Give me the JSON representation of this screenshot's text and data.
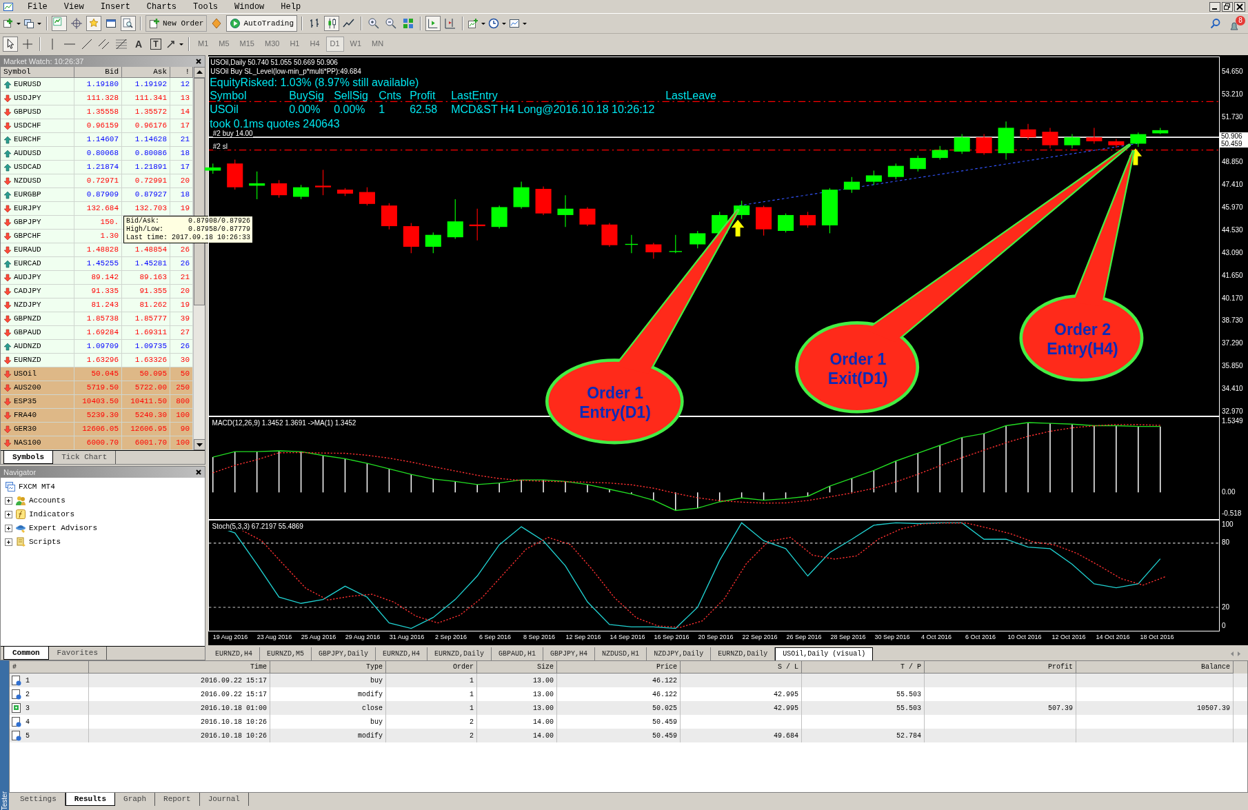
{
  "menu": [
    "File",
    "View",
    "Insert",
    "Charts",
    "Tools",
    "Window",
    "Help"
  ],
  "toolbar": {
    "new_order": "New Order",
    "autotrading": "AutoTrading",
    "text_tools": [
      "A",
      "T"
    ]
  },
  "timeframes": [
    {
      "label": "M1",
      "selected": false,
      "disabled": true
    },
    {
      "label": "M5",
      "selected": false,
      "disabled": true
    },
    {
      "label": "M15",
      "selected": false,
      "disabled": true
    },
    {
      "label": "M30",
      "selected": false,
      "disabled": true
    },
    {
      "label": "H1",
      "selected": false,
      "disabled": true
    },
    {
      "label": "H4",
      "selected": false,
      "disabled": true
    },
    {
      "label": "D1",
      "selected": true,
      "disabled": true
    },
    {
      "label": "W1",
      "selected": false,
      "disabled": true
    },
    {
      "label": "MN",
      "selected": false,
      "disabled": true
    }
  ],
  "notification_count": "8",
  "market_watch": {
    "title": "Market Watch: 10:26:37",
    "columns": [
      "Symbol",
      "Bid",
      "Ask",
      "!"
    ],
    "rows": [
      {
        "symbol": "EURUSD",
        "bid": "1.19180",
        "ask": "1.19192",
        "spread": "12",
        "rising": true,
        "highlighted": false
      },
      {
        "symbol": "USDJPY",
        "bid": "111.328",
        "ask": "111.341",
        "spread": "13",
        "rising": false,
        "highlighted": false
      },
      {
        "symbol": "GBPUSD",
        "bid": "1.35558",
        "ask": "1.35572",
        "spread": "14",
        "rising": false,
        "highlighted": false
      },
      {
        "symbol": "USDCHF",
        "bid": "0.96159",
        "ask": "0.96176",
        "spread": "17",
        "rising": false,
        "highlighted": false
      },
      {
        "symbol": "EURCHF",
        "bid": "1.14607",
        "ask": "1.14628",
        "spread": "21",
        "rising": true,
        "highlighted": false
      },
      {
        "symbol": "AUDUSD",
        "bid": "0.80068",
        "ask": "0.80086",
        "spread": "18",
        "rising": true,
        "highlighted": false
      },
      {
        "symbol": "USDCAD",
        "bid": "1.21874",
        "ask": "1.21891",
        "spread": "17",
        "rising": true,
        "highlighted": false
      },
      {
        "symbol": "NZDUSD",
        "bid": "0.72971",
        "ask": "0.72991",
        "spread": "20",
        "rising": false,
        "highlighted": false
      },
      {
        "symbol": "EURGBP",
        "bid": "0.87909",
        "ask": "0.87927",
        "spread": "18",
        "rising": true,
        "highlighted": false
      },
      {
        "symbol": "EURJPY",
        "bid": "132.684",
        "ask": "132.703",
        "spread": "19",
        "rising": false,
        "highlighted": false
      },
      {
        "symbol": "GBPJPY",
        "bid": "150.",
        "rising": false,
        "highlighted": false
      },
      {
        "symbol": "GBPCHF",
        "bid": "1.30",
        "rising": false,
        "highlighted": false
      },
      {
        "symbol": "EURAUD",
        "bid": "1.48828",
        "ask": "1.48854",
        "spread": "26",
        "rising": false,
        "highlighted": false
      },
      {
        "symbol": "EURCAD",
        "bid": "1.45255",
        "ask": "1.45281",
        "spread": "26",
        "rising": true,
        "highlighted": false
      },
      {
        "symbol": "AUDJPY",
        "bid": "89.142",
        "ask": "89.163",
        "spread": "21",
        "rising": false,
        "highlighted": false
      },
      {
        "symbol": "CADJPY",
        "bid": "91.335",
        "ask": "91.355",
        "spread": "20",
        "rising": false,
        "highlighted": false
      },
      {
        "symbol": "NZDJPY",
        "bid": "81.243",
        "ask": "81.262",
        "spread": "19",
        "rising": false,
        "highlighted": false
      },
      {
        "symbol": "GBPNZD",
        "bid": "1.85738",
        "ask": "1.85777",
        "spread": "39",
        "rising": false,
        "highlighted": false
      },
      {
        "symbol": "GBPAUD",
        "bid": "1.69284",
        "ask": "1.69311",
        "spread": "27",
        "rising": false,
        "highlighted": false
      },
      {
        "symbol": "AUDNZD",
        "bid": "1.09709",
        "ask": "1.09735",
        "spread": "26",
        "rising": true,
        "highlighted": false
      },
      {
        "symbol": "EURNZD",
        "bid": "1.63296",
        "ask": "1.63326",
        "spread": "30",
        "rising": false,
        "highlighted": false
      },
      {
        "symbol": "USOil",
        "bid": "50.045",
        "ask": "50.095",
        "spread": "50",
        "rising": false,
        "highlighted": true
      },
      {
        "symbol": "AUS200",
        "bid": "5719.50",
        "ask": "5722.00",
        "spread": "250",
        "rising": false,
        "highlighted": true
      },
      {
        "symbol": "ESP35",
        "bid": "10403.50",
        "ask": "10411.50",
        "spread": "800",
        "rising": false,
        "highlighted": true
      },
      {
        "symbol": "FRA40",
        "bid": "5239.30",
        "ask": "5240.30",
        "spread": "100",
        "rising": false,
        "highlighted": true
      },
      {
        "symbol": "GER30",
        "bid": "12606.05",
        "ask": "12606.95",
        "spread": "90",
        "rising": false,
        "highlighted": true
      },
      {
        "symbol": "NAS100",
        "bid": "6000.70",
        "ask": "6001.70",
        "spread": "100",
        "rising": false,
        "highlighted": true
      }
    ],
    "tooltip": [
      {
        "label": "Bid/Ask:",
        "value": "0.87908/0.87926"
      },
      {
        "label": "High/Low:",
        "value": "0.87958/0.87779"
      },
      {
        "label": "Last time:",
        "value": "2017.09.18 10:26:33"
      }
    ],
    "tabs": [
      {
        "label": "Symbols",
        "selected": true
      },
      {
        "label": "Tick Chart",
        "selected": false
      }
    ]
  },
  "navigator": {
    "title": "Navigator",
    "tree": [
      {
        "label": "FXCM MT4",
        "children": [
          {
            "label": "Accounts",
            "expanded": false
          },
          {
            "label": "Indicators",
            "expanded": false
          },
          {
            "label": "Expert Advisors",
            "expanded": false
          },
          {
            "label": "Scripts",
            "expanded": false
          }
        ]
      }
    ],
    "tabs": [
      {
        "label": "Common",
        "selected": true
      },
      {
        "label": "Favorites",
        "selected": false
      }
    ]
  },
  "chart": {
    "info": "USOil,Daily  50.740 51.055 50.669 50.906",
    "sl_info": "USOil Buy SL_Level(low-min_p*multi*PP):49.684",
    "equity": "EquityRisked: 1.03% (8.97% still available)",
    "signal_table": {
      "columns": [
        "Symbol",
        "BuySig",
        "SellSig",
        "Cnts",
        "Profit",
        "LastEntry",
        "LastLeave"
      ],
      "rows": [
        [
          "USOil",
          "0.00%",
          "0.00%",
          "1",
          "62.58",
          "MCD&ST H4 Long@2016.10.18 10:26:12"
        ]
      ]
    },
    "timing": "took 0.1ms quotes 240643",
    "lines": [
      {
        "label": "#2 buy 14.00",
        "kind": "order"
      },
      {
        "label": "#2 sl",
        "kind": "stop"
      }
    ],
    "callouts": [
      {
        "text": "Order 1 Entry(D1)"
      },
      {
        "text": "Order 1 Exit(D1)"
      },
      {
        "text": "Order 2 Entry(H4)"
      }
    ],
    "price_axis": {
      "above": [
        "54.650",
        "53.210",
        "51.730"
      ],
      "current": [
        "50.906",
        "50.459"
      ],
      "below": [
        "48.850",
        "47.410",
        "45.970",
        "44.530",
        "43.090",
        "41.650",
        "40.170",
        "38.730",
        "37.290",
        "35.850",
        "34.410",
        "32.970"
      ]
    },
    "macd": {
      "label": "MACD(12,26,9) 1.3452 1.3691 ->MA(1) 1.3452",
      "axis": [
        "1.5349",
        "0.00",
        "-0.518"
      ]
    },
    "stoch": {
      "label": "Stoch(5,3,3) 67.2197 55.4869",
      "axis": [
        "100",
        "80",
        "20",
        "0"
      ]
    },
    "dates": [
      "19 Aug 2016",
      "23 Aug 2016",
      "25 Aug 2016",
      "29 Aug 2016",
      "31 Aug 2016",
      "2 Sep 2016",
      "6 Sep 2016",
      "8 Sep 2016",
      "12 Sep 2016",
      "14 Sep 2016",
      "16 Sep 2016",
      "20 Sep 2016",
      "22 Sep 2016",
      "26 Sep 2016",
      "28 Sep 2016",
      "30 Sep 2016",
      "4 Oct 2016",
      "6 Oct 2016",
      "10 Oct 2016",
      "12 Oct 2016",
      "14 Oct 2016",
      "18 Oct 2016"
    ]
  },
  "chart_tabs": [
    {
      "label": "EURNZD,H4",
      "selected": false
    },
    {
      "label": "EURNZD,M5",
      "selected": false
    },
    {
      "label": "GBPJPY,Daily",
      "selected": false
    },
    {
      "label": "EURNZD,H4",
      "selected": false
    },
    {
      "label": "EURNZD,Daily",
      "selected": false
    },
    {
      "label": "GBPAUD,H1",
      "selected": false
    },
    {
      "label": "GBPJPY,H4",
      "selected": false
    },
    {
      "label": "NZDUSD,H1",
      "selected": false
    },
    {
      "label": "NZDJPY,Daily",
      "selected": false
    },
    {
      "label": "EURNZD,Daily",
      "selected": false
    },
    {
      "label": "USOil,Daily (visual)",
      "selected": true
    }
  ],
  "tester": {
    "side_label": "Tester",
    "columns": [
      "#",
      "Time",
      "Type",
      "Order",
      "Size",
      "Price",
      "S / L",
      "T / P",
      "Profit",
      "Balance"
    ],
    "rows": [
      {
        "kind": "trade",
        "num": "1",
        "time": "2016.09.22 15:17",
        "type": "buy",
        "order": "1",
        "size": "13.00",
        "price": "46.122"
      },
      {
        "kind": "trade",
        "num": "2",
        "time": "2016.09.22 15:17",
        "type": "modify",
        "order": "1",
        "size": "13.00",
        "price": "46.122",
        "sl": "42.995",
        "tp": "55.503"
      },
      {
        "kind": "close",
        "num": "3",
        "time": "2016.10.18 01:00",
        "type": "close",
        "order": "1",
        "size": "13.00",
        "price": "50.025",
        "sl": "42.995",
        "tp": "55.503",
        "profit": "507.39",
        "balance": "10507.39"
      },
      {
        "kind": "trade",
        "num": "4",
        "time": "2016.10.18 10:26",
        "type": "buy",
        "order": "2",
        "size": "14.00",
        "price": "50.459"
      },
      {
        "kind": "trade",
        "num": "5",
        "time": "2016.10.18 10:26",
        "type": "modify",
        "order": "2",
        "size": "14.00",
        "price": "50.459",
        "sl": "49.684",
        "tp": "52.784"
      }
    ],
    "tabs": [
      {
        "label": "Settings",
        "selected": false
      },
      {
        "label": "Results",
        "selected": true
      },
      {
        "label": "Graph",
        "selected": false
      },
      {
        "label": "Report",
        "selected": false
      },
      {
        "label": "Journal",
        "selected": false
      }
    ]
  }
}
